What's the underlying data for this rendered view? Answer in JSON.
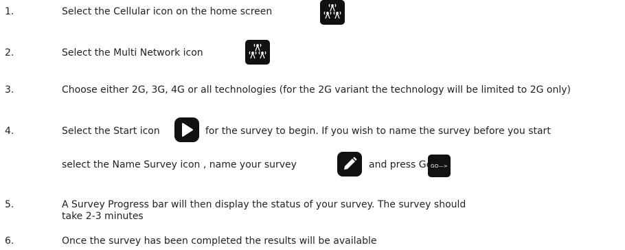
{
  "steps": [
    {
      "number": "1.",
      "text": "Select the Cellular icon on the home screen"
    },
    {
      "number": "2.",
      "text": "Select the Multi Network icon"
    },
    {
      "number": "3.",
      "text": "Choose either 2G, 3G, 4G or all technologies (for the 2G variant the technology will be limited to 2G only)"
    },
    {
      "number": "4.",
      "text_part1": "Select the Start icon",
      "text_part2": "for the survey to begin. If you wish to name the survey before you start",
      "text_part3": "select the Name Survey icon , name your survey",
      "text_part4": "and press Go"
    },
    {
      "number": "5.",
      "text": "A Survey Progress bar will then display the status of your survey. The survey should take 2-3 minutes"
    },
    {
      "number": "6.",
      "text": "Once the survey has been completed the results will be available"
    }
  ],
  "icons": {
    "cellular": "cellular-towers-icon",
    "multi_network": "multi-network-icon",
    "start": "play-icon",
    "name_survey": "pencil-icon",
    "go": "go-arrow-icon",
    "go_label": "GO—>"
  },
  "colors": {
    "icon_bg": "#111111",
    "text": "#222222"
  }
}
